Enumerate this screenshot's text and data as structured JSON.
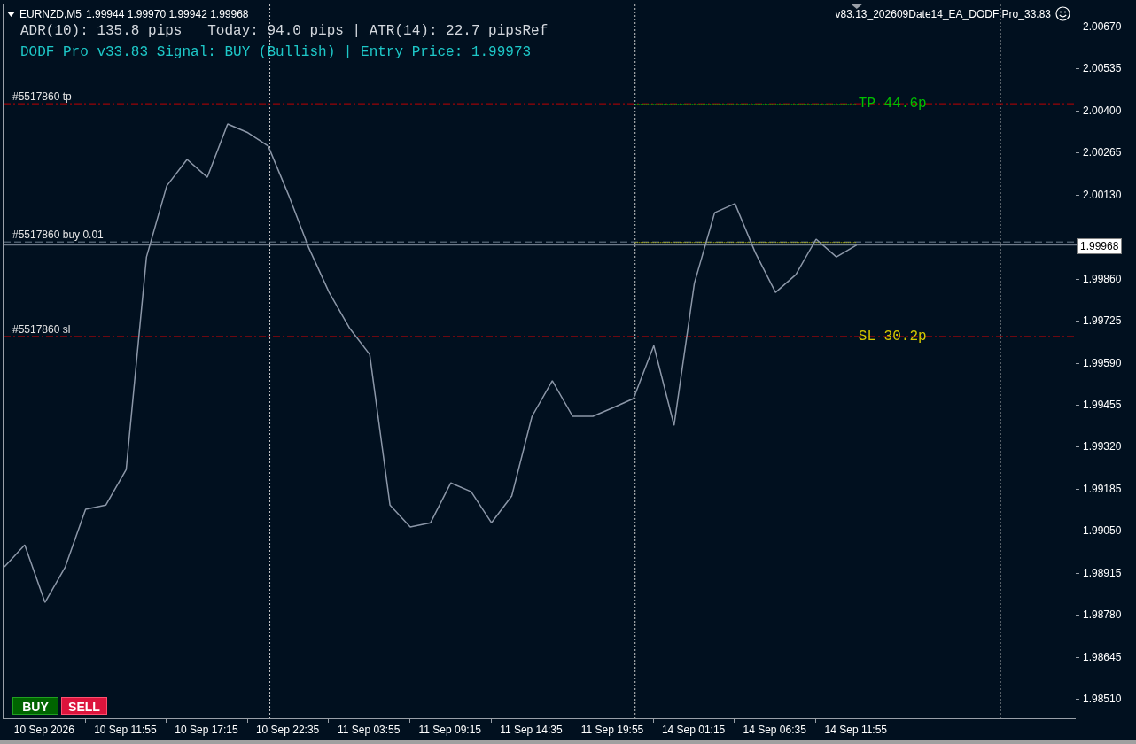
{
  "header": {
    "symbol": "EURNZD,M5",
    "ohlc": "1.99944 1.99970 1.99942 1.99968",
    "expert": "v83.13_202609Date14_EA_DODF Pro_33.83"
  },
  "info_lines": [
    {
      "kind": "stats",
      "text": "ADR(10): 135.8 pips   Today: 94.0 pips | ATR(14): 22.7 pipsRef"
    },
    {
      "kind": "signal",
      "text": "DODF Pro v33.83 Signal: BUY (Bullish) | Entry Price: 1.99973"
    }
  ],
  "chart": {
    "chart_data": {
      "type": "line",
      "categories": [
        null,
        null,
        "10 Sep 2026",
        null,
        null,
        null,
        "10 Sep 11:55",
        null,
        null,
        null,
        "10 Sep 17:15",
        null,
        null,
        null,
        "10 Sep 22:35",
        null,
        null,
        null,
        "11 Sep 03:55",
        null,
        null,
        null,
        "11 Sep 09:15",
        null,
        null,
        null,
        "11 Sep 14:35",
        null,
        null,
        null,
        "11 Sep 19:55",
        null,
        null,
        null,
        "14 Sep 01:15",
        null,
        null,
        null,
        "14 Sep 06:35",
        null,
        null,
        null,
        "14 Sep 11:55"
      ],
      "series": [
        {
          "color": "#8c97a8",
          "values": [
            1.98934,
            1.99005,
            1.9882,
            1.98934,
            1.99119,
            1.99133,
            1.99247,
            1.9993,
            2.00158,
            2.00243,
            2.00186,
            2.00357,
            2.00329,
            2.00286,
            2.00129,
            1.99959,
            1.99816,
            1.99702,
            1.99617,
            1.99133,
            1.99062,
            1.99076,
            1.99204,
            1.99176,
            1.99076,
            1.99162,
            1.99418,
            1.99532,
            1.99418,
            1.99418,
            1.99446,
            1.99475,
            1.99645,
            1.99389,
            1.99845,
            2.00072,
            2.00101,
            1.99944,
            1.99816,
            1.99873,
            1.99987,
            1.9993,
            1.99968
          ]
        }
      ],
      "ylim": [
        1.98445,
        2.00741
      ],
      "yticks": [
        {
          "value": 2.0067,
          "label": "2.00670"
        },
        {
          "value": 2.00535,
          "label": "2.00535"
        },
        {
          "value": 2.004,
          "label": "2.00400"
        },
        {
          "value": 2.00265,
          "label": "2.00265"
        },
        {
          "value": 2.0013,
          "label": "2.00130"
        },
        {
          "value": 1.9986,
          "label": "1.99860"
        },
        {
          "value": 1.99725,
          "label": "1.99725"
        },
        {
          "value": 1.9959,
          "label": "1.99590"
        },
        {
          "value": 1.99455,
          "label": "1.99455"
        },
        {
          "value": 1.9932,
          "label": "1.99320"
        },
        {
          "value": 1.99185,
          "label": "1.99185"
        },
        {
          "value": 1.9905,
          "label": "1.99050"
        },
        {
          "value": 1.98915,
          "label": "1.98915"
        },
        {
          "value": 1.9878,
          "label": "1.98780"
        },
        {
          "value": 1.98645,
          "label": "1.98645"
        },
        {
          "value": 1.9851,
          "label": "1.98510"
        }
      ],
      "ref_lines": [
        {
          "axis": "y",
          "value": 2.00422,
          "label": "#5517860 tp"
        },
        {
          "axis": "y",
          "value": 1.99978,
          "label": "#5517860 buy 0.01"
        },
        {
          "axis": "y",
          "value": 1.99674,
          "label": "#5517860 sl"
        },
        {
          "axis": "y",
          "value": 1.99968,
          "label": "1.99968"
        }
      ]
    },
    "order_lines": [
      {
        "kind": "tp",
        "tag": "TP 44.6p"
      },
      {
        "kind": "entry"
      },
      {
        "kind": "sl",
        "tag": "SL 30.2p"
      },
      {
        "kind": "bid"
      }
    ]
  },
  "buttons": [
    {
      "kind": "buy",
      "label": "BUY"
    },
    {
      "kind": "sell",
      "label": "SELL"
    }
  ]
}
